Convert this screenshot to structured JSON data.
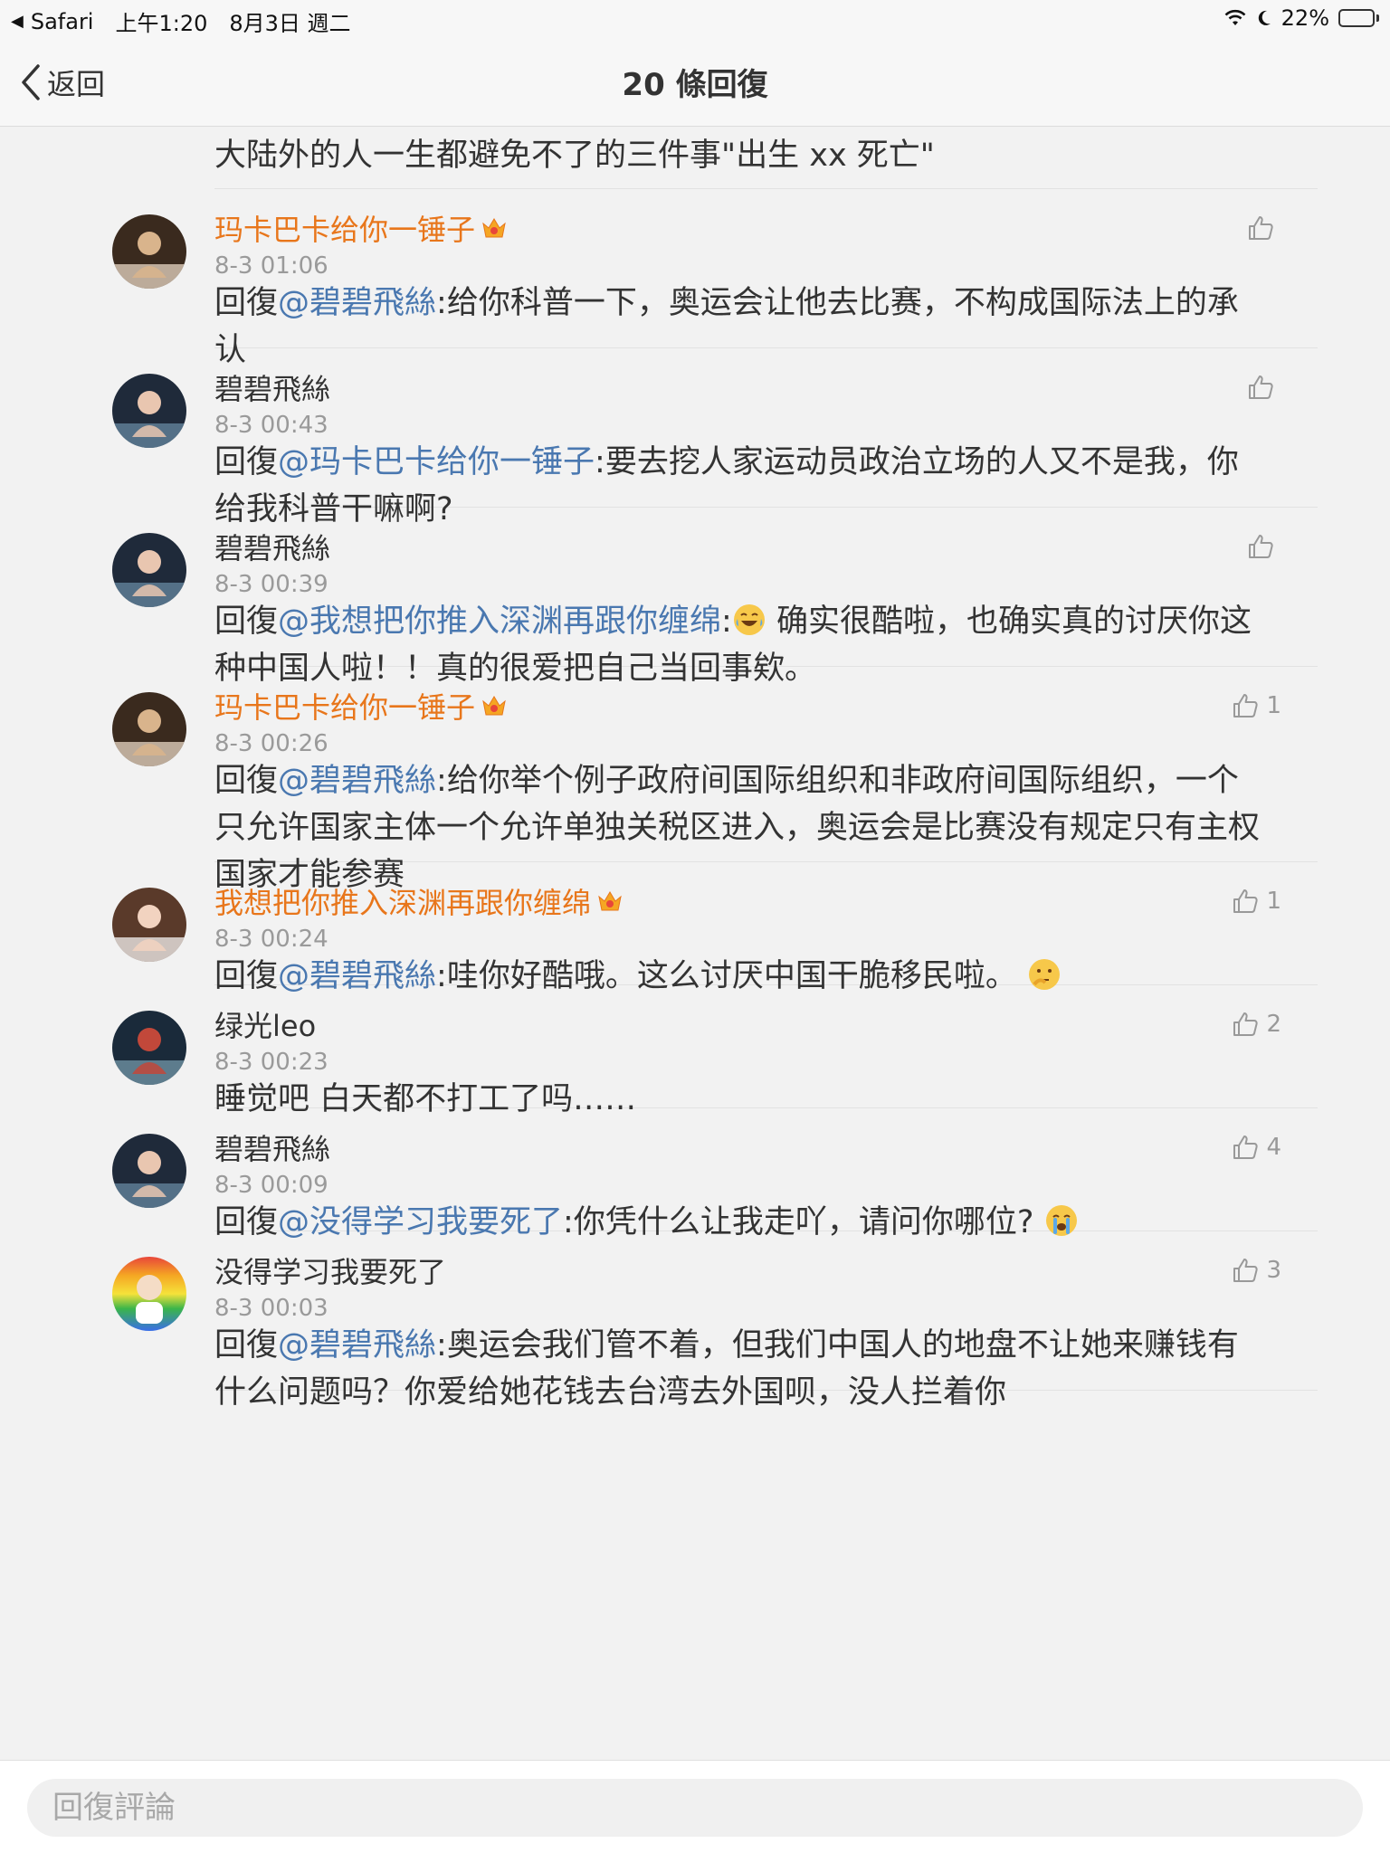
{
  "status_bar": {
    "back_app": "Safari",
    "time": "上午1:20",
    "date": "8月3日 週二",
    "battery": "22%",
    "battery_level": 0.22
  },
  "nav": {
    "back_label": "返回",
    "title": "20 條回復"
  },
  "top_snippet": "大陆外的人一生都避免不了的三件事\"出生 xx 死亡\"",
  "comments": [
    {
      "username": "玛卡巴卡给你一锤子",
      "vip": true,
      "timestamp": "8-3 01:06",
      "reply_prefix": "回復",
      "mention": "@碧碧飛絲",
      "text": ":给你科普一下，奥运会让他去比赛，不构成国际法上的承认",
      "likes": ""
    },
    {
      "username": "碧碧飛絲",
      "vip": false,
      "timestamp": "8-3 00:43",
      "reply_prefix": "回復",
      "mention": "@玛卡巴卡给你一锤子",
      "text": ":要去挖人家运动员政治立场的人又不是我，你给我科普干嘛啊?",
      "likes": ""
    },
    {
      "username": "碧碧飛絲",
      "vip": false,
      "timestamp": "8-3 00:39",
      "reply_prefix": "回復",
      "mention": "@我想把你推入深渊再跟你缠绵",
      "text": ": 确实很酷啦，也确实真的讨厌你这种中国人啦！！真的很爱把自己当回事欸。",
      "emoji": "laugh-cry",
      "likes": ""
    },
    {
      "username": "玛卡巴卡给你一锤子",
      "vip": true,
      "timestamp": "8-3 00:26",
      "reply_prefix": "回復",
      "mention": "@碧碧飛絲",
      "text": ":给你举个例子政府间国际组织和非政府间国际组织，一个只允许国家主体一个允许单独关税区进入，奥运会是比赛没有规定只有主权国家才能参赛",
      "likes": "1"
    },
    {
      "username": "我想把你推入深渊再跟你缠绵",
      "vip": true,
      "timestamp": "8-3 00:24",
      "reply_prefix": "回復",
      "mention": "@碧碧飛絲",
      "text": ":哇你好酷哦。这么讨厌中国干脆移民啦。",
      "emoji_after": "thinking",
      "likes": "1"
    },
    {
      "username": "绿光leo",
      "vip": false,
      "timestamp": "8-3 00:23",
      "reply_prefix": "",
      "mention": "",
      "text": "睡觉吧 白天都不打工了吗……",
      "likes": "2"
    },
    {
      "username": "碧碧飛絲",
      "vip": false,
      "timestamp": "8-3 00:09",
      "reply_prefix": "回復",
      "mention": "@没得学习我要死了",
      "text": ":你凭什么让我走吖，请问你哪位?",
      "emoji_after": "crying",
      "likes": "4"
    },
    {
      "username": "没得学习我要死了",
      "vip": false,
      "timestamp": "8-3 00:03",
      "reply_prefix": "回復",
      "mention": "@碧碧飛絲",
      "text": ":奥运会我们管不着，但我们中国人的地盘不让她来赚钱有什么问题吗？你爱给她花钱去台湾去外国呗，没人拦着你",
      "likes": "3"
    }
  ],
  "reply_bar": {
    "placeholder": "回復評論"
  }
}
